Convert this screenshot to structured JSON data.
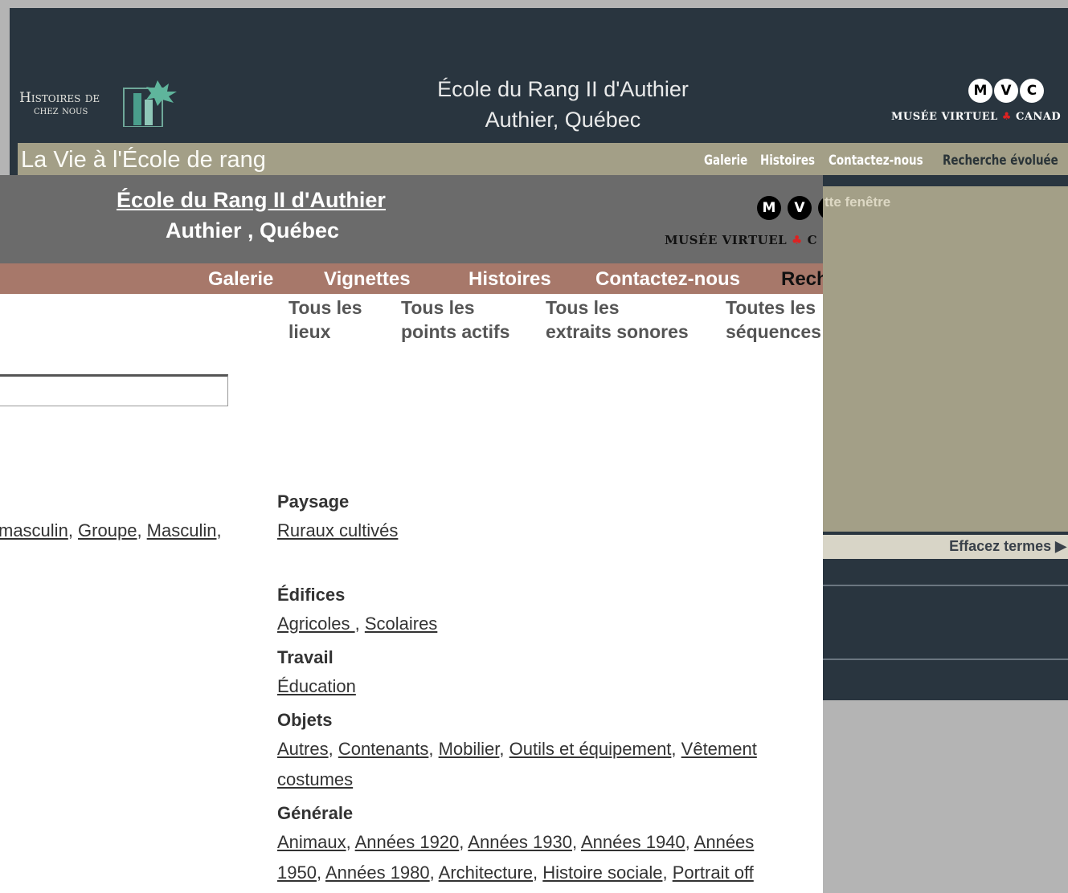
{
  "back_window": {
    "logo_line1": "Histoires de",
    "logo_line2": "chez nous",
    "title_line1": "École du Rang II d'Authier",
    "title_line2": "Authier, Québec",
    "mvc_letters": [
      "M",
      "V",
      "C"
    ],
    "mvc_text": "MUSÉE VIRTUEL",
    "mvc_text_suffix": "CANAD",
    "band_title": "La Vie à l'École de rang",
    "nav": [
      "Galerie",
      "Histoires",
      "Contactez-nous",
      "Recherche évoluée"
    ],
    "panel_text": "tte fenêtre",
    "effacez_label": "Effacez termes ▶"
  },
  "front_window": {
    "title_line1": "École du Rang II d'Authier",
    "title_line2": "Authier , Québec",
    "mvc_letters": [
      "M",
      "V",
      "C"
    ],
    "mvc_text": "MUSÉE VIRTUEL",
    "mvc_suffix": "C",
    "nav": {
      "galerie": "Galerie",
      "vignettes": "Vignettes",
      "histoires": "Histoires",
      "contactez": "Contactez-nous",
      "recherche": "Rech"
    },
    "sub_links": [
      {
        "line1": "Tous les",
        "line2": "lieux"
      },
      {
        "line1": "Tous les",
        "line2": "points actifs"
      },
      {
        "line1": "Tous les",
        "line2": "extraits sonores"
      },
      {
        "line1": "Toutes les",
        "line2": "séquences"
      }
    ],
    "search_value": "",
    "left_terms": [
      "masculin",
      "Groupe",
      "Masculin"
    ],
    "categories": {
      "paysage": {
        "head": "Paysage",
        "items": [
          "Ruraux cultivés"
        ]
      },
      "edifices": {
        "head": "Édifices",
        "items": [
          "Agricoles ",
          "Scolaires"
        ]
      },
      "travail": {
        "head": "Travail",
        "items": [
          "Éducation"
        ]
      },
      "objets": {
        "head": "Objets",
        "items": [
          "Autres",
          "Contenants",
          "Mobilier",
          "Outils et équipement",
          "Vêtement",
          "costumes"
        ]
      },
      "generale": {
        "head": "Générale",
        "items": [
          "Animaux",
          "Années 1920",
          "Années 1930",
          "Années 1940",
          "Années",
          "1950",
          "Années 1980",
          "Architecture",
          "Histoire sociale",
          "Portrait off"
        ]
      }
    }
  },
  "colors": {
    "back_bg": "#29353f",
    "back_band": "#a39f87",
    "front_header": "#6b6b6b",
    "front_nav": "#a7786a",
    "desktop": "#b4b4b4"
  }
}
